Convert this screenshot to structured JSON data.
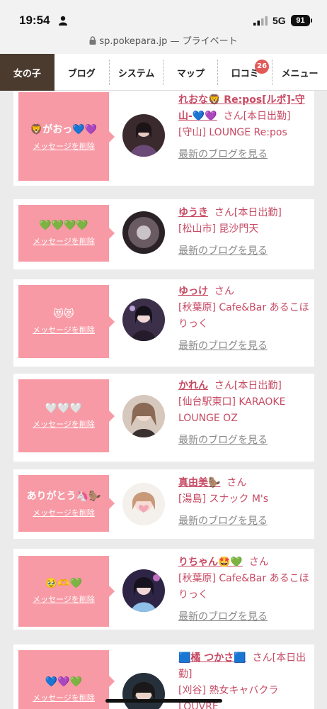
{
  "status": {
    "time": "19:54",
    "network": "5G",
    "battery": "91"
  },
  "urlbar": {
    "host": "sp.pokepara.jp",
    "mode": "— プライベート"
  },
  "nav": {
    "tabs": [
      {
        "label": "女の子"
      },
      {
        "label": "ブログ"
      },
      {
        "label": "システム"
      },
      {
        "label": "マップ"
      },
      {
        "label": "口コミ",
        "badge": "26"
      },
      {
        "label": "メニュー"
      }
    ]
  },
  "common": {
    "delete_label": "メッセージを削除",
    "blog_label": "最新のブログを見る"
  },
  "entries": [
    {
      "message": "🦁がおっ💙💜",
      "name": "れおな🦁 Re:pos[ルポ]-守山-💙💜",
      "suffix": "さん[本日出勤]",
      "shop": "[守山] LOUNGE Re:pos"
    },
    {
      "message": "💚💚💚💚",
      "name": "ゆうき",
      "suffix": "さん[本日出勤]",
      "shop": "[松山市] 昆沙門天"
    },
    {
      "message": "😻😻",
      "name": "ゆっけ",
      "suffix": "さん",
      "shop": "[秋葉原] Cafe&Bar あるこほりっく"
    },
    {
      "message": "🤍🤍🤍",
      "name": "かれん",
      "suffix": "さん[本日出勤]",
      "shop": "[仙台駅東口] KARAOKE LOUNGE OZ"
    },
    {
      "message": "ありがとう🦄🦫",
      "name": "真由美🦫",
      "suffix": "さん",
      "shop": "[湯島] スナック M's"
    },
    {
      "message": "🥹🫶💚",
      "name": "りちゃん🤩💚",
      "suffix": "さん",
      "shop": "[秋葉原] Cafe&Bar あるこほりっく"
    },
    {
      "message": "💙💜💚",
      "name": "🟦橘 つかさ🟦",
      "suffix": "さん[本日出勤]",
      "shop": "[刈谷] 熟女キャバクラ LOUVRE"
    }
  ]
}
